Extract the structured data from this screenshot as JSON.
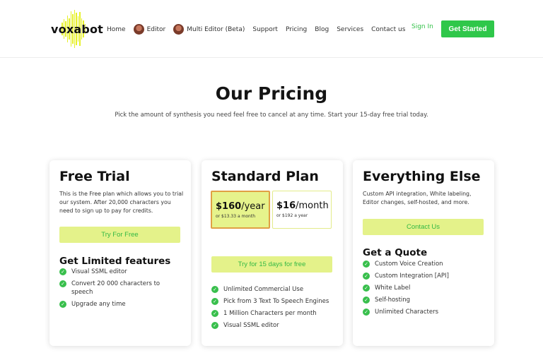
{
  "brand": {
    "name": "voxabot",
    "accent": "#2fc74a",
    "logo_color": "#e6f02a"
  },
  "nav": {
    "items": [
      {
        "label": "Home",
        "avatar": false
      },
      {
        "label": "Editor",
        "avatar": true
      },
      {
        "label": "Multi Editor (Beta)",
        "avatar": true
      },
      {
        "label": "Support",
        "avatar": false
      },
      {
        "label": "Pricing",
        "avatar": false
      },
      {
        "label": "Blog",
        "avatar": false
      },
      {
        "label": "Services",
        "avatar": false
      },
      {
        "label": "Contact us",
        "avatar": false
      }
    ],
    "sign_in": "Sign In",
    "get_started": "Get Started"
  },
  "hero": {
    "title": "Our Pricing",
    "subtitle": "Pick the amount of synthesis you need feel free to cancel at any time. Start your 15-day free trial today."
  },
  "plans": {
    "free": {
      "title": "Free Trial",
      "description": "This is the Free plan which allows you to trial our system. After 20,000 characters you need to sign up to pay for credits.",
      "button": "Try For Free",
      "features_title": "Get Limited features",
      "features": [
        "Visual SSML editor",
        "Convert 20 000 characters to speech",
        "Upgrade any time"
      ]
    },
    "standard": {
      "title": "Standard Plan",
      "yearly": {
        "amount": "$160",
        "period": "/year",
        "note": "or $13.33 a month",
        "selected": true
      },
      "monthly": {
        "amount": "$16",
        "period": "/month",
        "note": "or $192 a year",
        "selected": false
      },
      "button": "Try for 15 days for free",
      "features": [
        "Unlimited Commercial Use",
        "Pick from 3 Text To Speech Engines",
        "1 Million Characters per month",
        "Visual SSML editor"
      ]
    },
    "everything": {
      "title": "Everything Else",
      "description": "Custom API integration, White labeling, Editor changes, self-hosted, and more.",
      "button": "Contact Us",
      "features_title": "Get a Quote",
      "features": [
        "Custom Voice Creation",
        "Custom Integration [API]",
        "White Label",
        "Self-hosting",
        "Unlimited Characters"
      ]
    }
  }
}
